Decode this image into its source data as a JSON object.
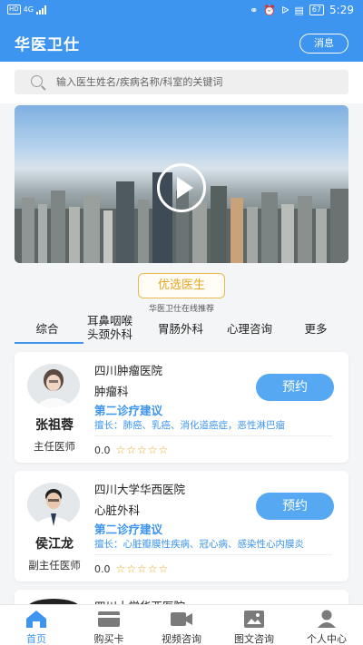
{
  "status": {
    "network_badge": "HD",
    "network_type": "4G",
    "battery": "67",
    "time": "5:29"
  },
  "header": {
    "title": "华医卫仕",
    "message_button": "消息"
  },
  "search": {
    "placeholder": "输入医生姓名/疾病名称/科室的关键词"
  },
  "recommend": {
    "title": "优选医生",
    "subtitle": "华医卫仕在线推荐"
  },
  "tabs": [
    {
      "label": "综合"
    },
    {
      "label_line1": "耳鼻咽喉",
      "label_line2": "头颈外科"
    },
    {
      "label": "胃肠外科"
    },
    {
      "label": "心理咨询"
    },
    {
      "label": "更多"
    }
  ],
  "doctors": [
    {
      "name": "张祖蓉",
      "title": "主任医师",
      "hospital": "四川肿瘤医院",
      "department": "肿瘤科",
      "clinic": "第二诊疗建议",
      "skill": "擅长：肺癌、乳癌、消化道癌症，恶性淋巴瘤",
      "rating": "0.0",
      "stars": "☆☆☆☆☆",
      "book": "预约"
    },
    {
      "name": "侯江龙",
      "title": "副主任医师",
      "hospital": "四川大学华西医院",
      "department": "心脏外科",
      "clinic": "第二诊疗建议",
      "skill": "擅长：心脏瓣膜性疾病、冠心病、感染性心内膜炎",
      "rating": "0.0",
      "stars": "☆☆☆☆☆",
      "book": "预约"
    },
    {
      "hospital": "四川大学华西医院"
    }
  ],
  "bottom_nav": [
    {
      "label": "首页",
      "icon": "home-icon"
    },
    {
      "label": "购买卡",
      "icon": "card-icon"
    },
    {
      "label": "视频咨询",
      "icon": "video-icon"
    },
    {
      "label": "图文咨询",
      "icon": "image-text-icon"
    },
    {
      "label": "个人中心",
      "icon": "person-icon"
    }
  ],
  "colors": {
    "primary": "#3d95ef",
    "accent": "#e8a623"
  }
}
